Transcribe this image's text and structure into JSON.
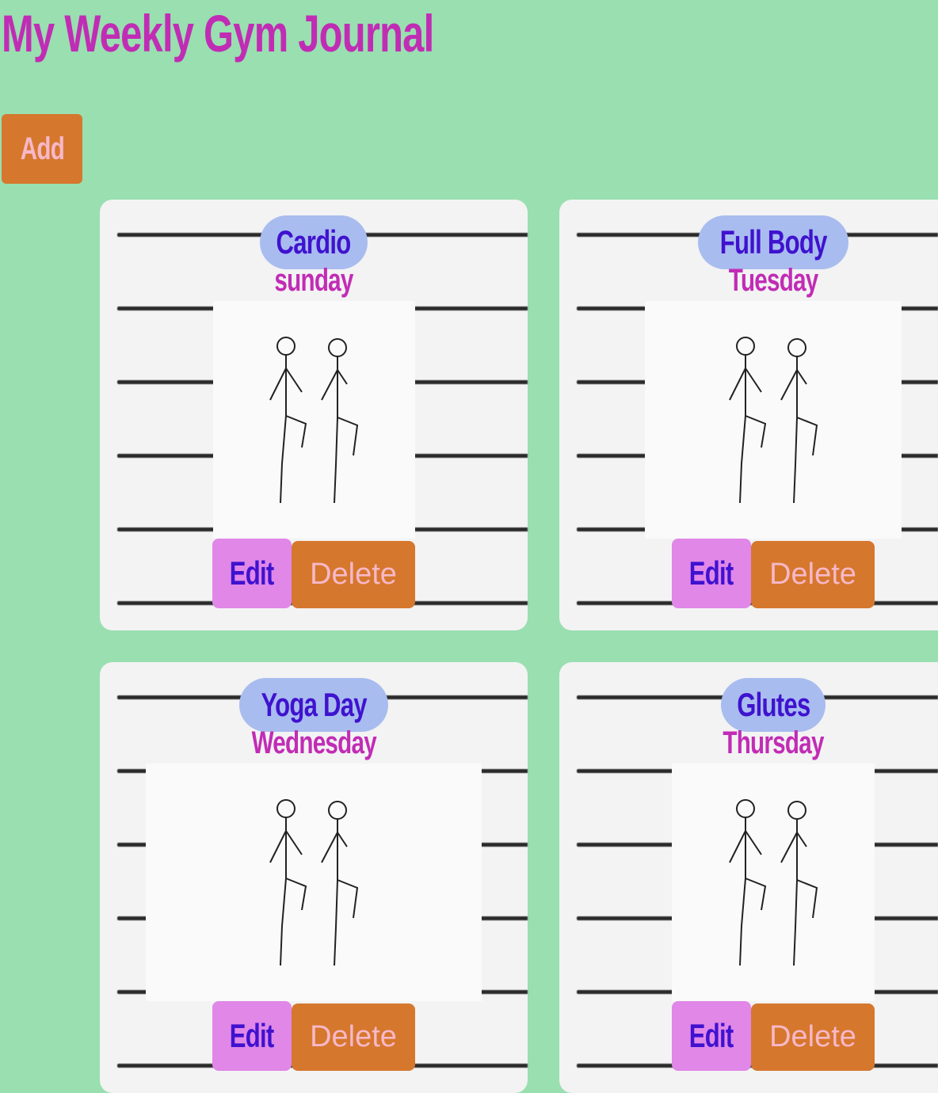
{
  "header": {
    "title": "My Weekly Gym Journal"
  },
  "toolbar": {
    "add_label": "Add"
  },
  "colors": {
    "background": "#99dfb0",
    "title": "#c12cb5",
    "badge": "#a9bcef",
    "badge_text": "#3f12cf",
    "edit": "#e087e8",
    "delete": "#d6772e",
    "button_text_light": "#f7b8c8"
  },
  "workouts": [
    {
      "name": "Cardio",
      "day": "sunday",
      "image": "high-knees-illustration",
      "edit_label": "Edit",
      "delete_label": "Delete"
    },
    {
      "name": "Full Body",
      "day": "Tuesday",
      "image": "plank-rotation-illustration",
      "edit_label": "Edit",
      "delete_label": "Delete"
    },
    {
      "name": "Yoga Day",
      "day": "Wednesday",
      "image": "yoga-illustration",
      "edit_label": "Edit",
      "delete_label": "Delete"
    },
    {
      "name": "Glutes",
      "day": "Thursday",
      "image": "glute-stretch-illustration",
      "edit_label": "Edit",
      "delete_label": "Delete"
    }
  ]
}
